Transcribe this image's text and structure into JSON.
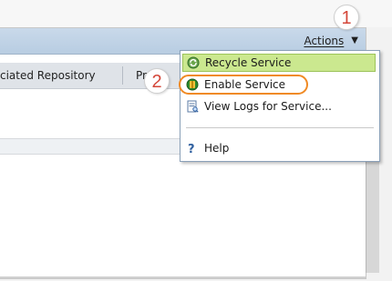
{
  "header": {
    "actions_label": "Actions"
  },
  "table": {
    "col1_title": "ciated Repository",
    "col2_title": "Pr"
  },
  "menu": {
    "items": [
      {
        "label": "Recycle Service",
        "icon": "recycle-icon",
        "highlighted": true
      },
      {
        "label": "Enable Service",
        "icon": "enable-icon",
        "highlighted": false
      },
      {
        "label": "View Logs for Service...",
        "icon": "view-logs-icon",
        "highlighted": false
      },
      {
        "label": "Help",
        "icon": "help-icon",
        "highlighted": false
      }
    ]
  },
  "annotations": {
    "callout1": "1",
    "callout2": "2",
    "callout_color": "#d4473a",
    "oval_color": "#f08a24"
  },
  "colors": {
    "menu_highlight": "#cbe88f",
    "toolbar": "#c9d9ea"
  }
}
